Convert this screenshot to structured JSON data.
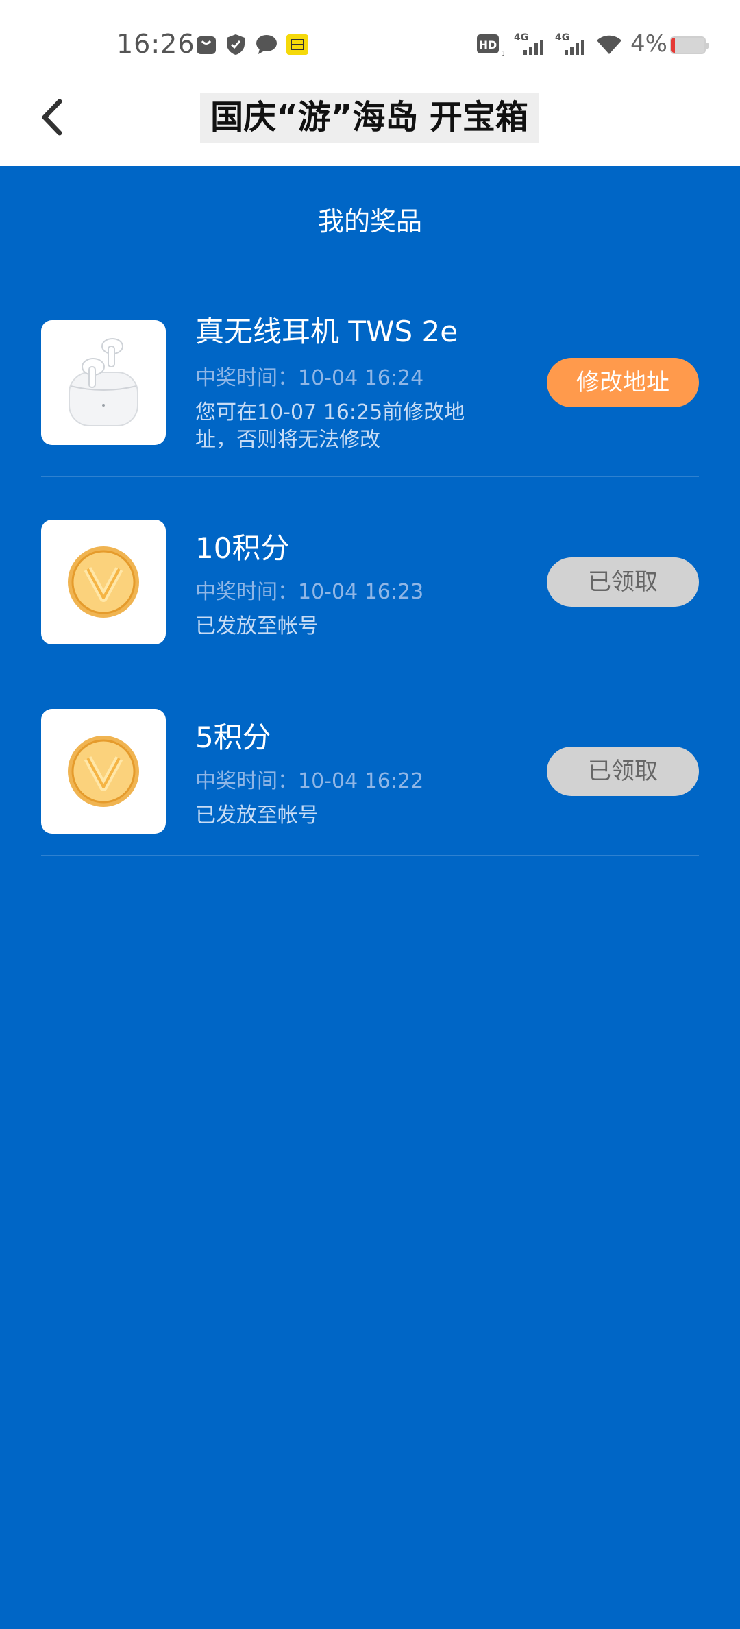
{
  "status_bar": {
    "time": "16:26",
    "battery_text": "4%",
    "icons": [
      "bag-icon",
      "shield-icon",
      "chat-bubble-icon",
      "app-badge-icon",
      "hd-icon",
      "signal-4g-icon",
      "signal-4g-icon",
      "wifi-icon",
      "battery-icon"
    ],
    "hd_label": "HD",
    "net_label_1": "4G",
    "net_label_2": "4G"
  },
  "header": {
    "title": "国庆“游”海岛 开宝箱",
    "back_icon": "chevron-left-icon"
  },
  "section": {
    "title": "我的奖品"
  },
  "prizes": [
    {
      "name": "真无线耳机 TWS 2e",
      "time": "中奖时间：10-04 16:24",
      "note": "您可在10-07 16:25前修改地址，否则将无法修改",
      "action": "修改地址",
      "thumb": "earbuds-image"
    },
    {
      "name": "10积分",
      "time": "中奖时间：10-04 16:23",
      "note": "已发放至帐号",
      "action": "已领取",
      "thumb": "coin-icon"
    },
    {
      "name": "5积分",
      "time": "中奖时间：10-04 16:22",
      "note": "已发放至帐号",
      "action": "已领取",
      "thumb": "coin-icon"
    }
  ],
  "colors": {
    "background": "#0066c6",
    "accent_orange": "#ff9a4c",
    "disabled_gray": "#d2d2d2"
  }
}
